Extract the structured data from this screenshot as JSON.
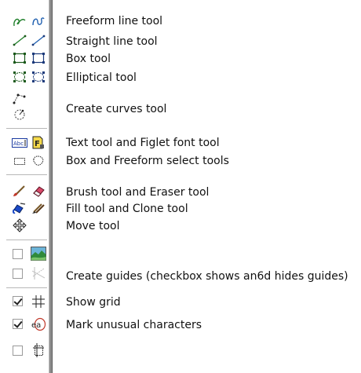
{
  "labels": {
    "freeform_line": "Freeform line tool",
    "straight_line": "Straight line tool",
    "box": "Box tool",
    "elliptical": "Elliptical tool",
    "create_curves": "Create curves tool",
    "text_figlet": "Text tool and Figlet font tool",
    "box_freeform_select": "Box and Freeform select tools",
    "brush_eraser": "Brush tool and Eraser tool",
    "fill_clone": "Fill tool and Clone tool",
    "move": "Move tool",
    "create_guides": "Create guides (checkbox shows an6d hides guides)",
    "show_grid": "Show grid",
    "mark_unusual": "Mark unusual characters"
  },
  "icons": {
    "text_tool_glyph": "Abc"
  },
  "checkboxes": {
    "image_toggle": false,
    "guides_toggle": false,
    "show_grid": true,
    "mark_unusual": true,
    "last_toggle": false
  },
  "colors": {
    "line_tool": "#1f7f2a",
    "curve_tool": "#1f5fb0",
    "box_tool": "#1c5a1c",
    "text_bg": "#1a3aa0",
    "brush": "#c0392b",
    "fill": "#1a49c8",
    "clone": "#7a5a2a"
  }
}
